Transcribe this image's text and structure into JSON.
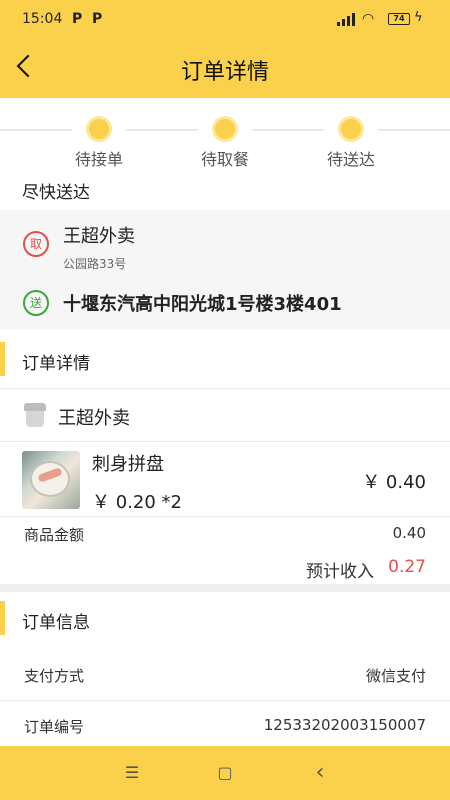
{
  "status_bar": {
    "time": "15:04",
    "p1": "P",
    "p2": "P",
    "battery": "74"
  },
  "header": {
    "title": "订单详情"
  },
  "steps": [
    {
      "label": "待接单"
    },
    {
      "label": "待取餐"
    },
    {
      "label": "待送达"
    }
  ],
  "delivery": {
    "heading": "尽快送达",
    "pickup_tag": "取",
    "shop_name": "王超外卖",
    "shop_address": "公园路33号",
    "deliver_tag": "送",
    "destination": "十堰东汽高中阳光城1号楼3楼401"
  },
  "order_detail": {
    "heading": "订单详情",
    "store_name": "王超外卖",
    "item": {
      "name": "刺身拼盘",
      "price_qty": "￥ 0.20 *2",
      "total": "￥ 0.40"
    },
    "amount_label": "商品金额",
    "amount_value": "0.40",
    "income_label": "预计收入",
    "income_value": "0.27"
  },
  "order_info": {
    "heading": "订单信息",
    "payment_label": "支付方式",
    "payment_value": "微信支付",
    "number_label": "订单编号",
    "number_value": "12533202003150007"
  },
  "nav": {
    "menu": "☰",
    "home": "▢",
    "back": "‹"
  },
  "colors": {
    "accent": "#fbd04a",
    "pickup": "#e05050",
    "deliver": "#3aa93a",
    "income": "#e05050"
  }
}
